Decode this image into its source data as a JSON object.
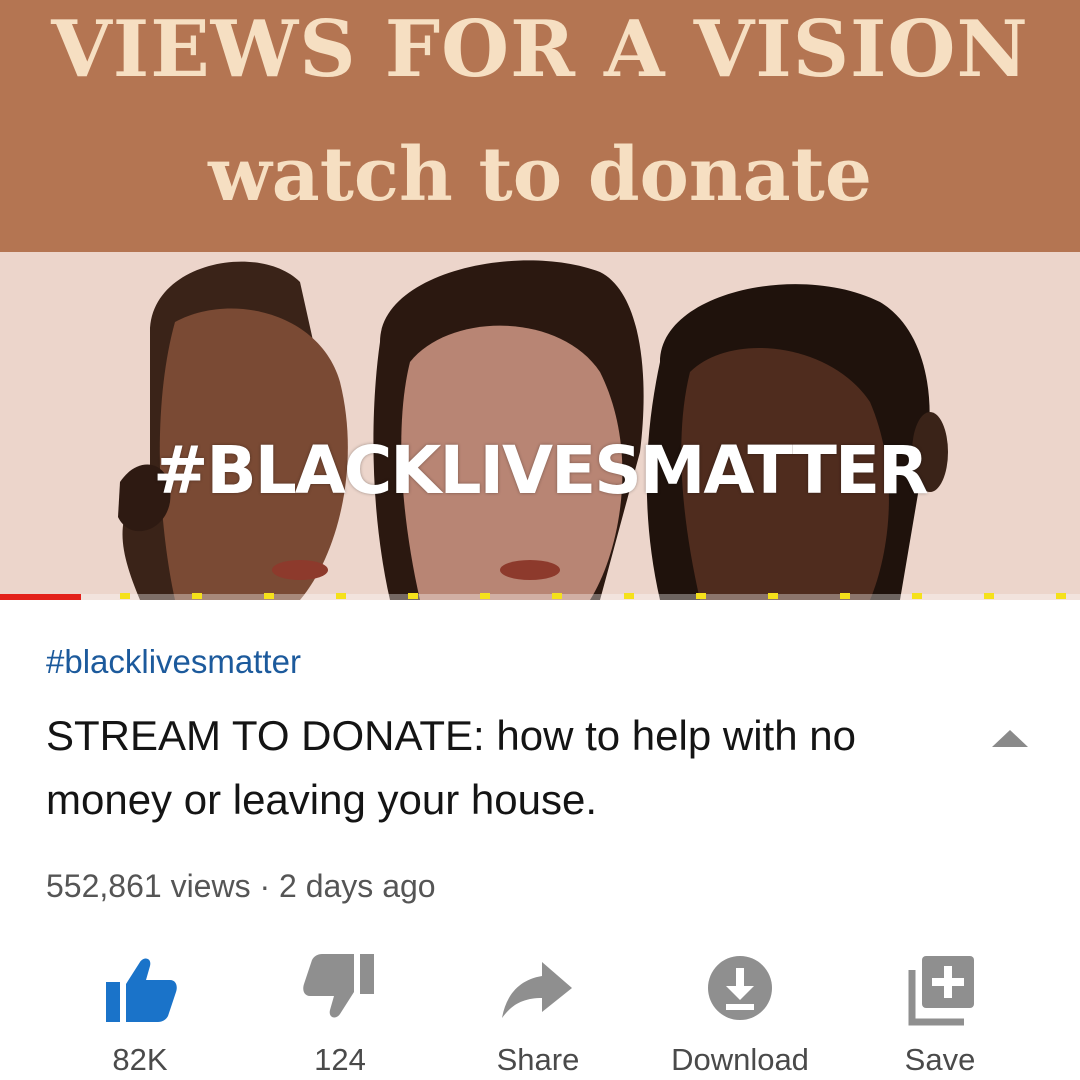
{
  "thumbnail": {
    "banner_title": "VIEWS FOR A VISION",
    "banner_subtitle": "watch to donate",
    "overlay_text": "#BLACKLIVESMATTER",
    "watched_fraction": 0.075
  },
  "video": {
    "hashtag": "#blacklivesmatter",
    "title": "STREAM TO DONATE: how to help with no money or leaving your house.",
    "meta": "552,861 views · 2 days ago"
  },
  "actions": {
    "like": {
      "icon": "thumbs-up-icon",
      "label": "82K"
    },
    "dislike": {
      "icon": "thumbs-down-icon",
      "label": "124"
    },
    "share": {
      "icon": "share-arrow-icon",
      "label": "Share"
    },
    "download": {
      "icon": "download-icon",
      "label": "Download"
    },
    "save": {
      "icon": "playlist-add-icon",
      "label": "Save"
    }
  },
  "colors": {
    "banner": "#b47552",
    "banner_text": "#f6dfc2",
    "link": "#1c5a9c",
    "like_active": "#1a73c9",
    "progress": "#e32119",
    "ad_marker": "#f5e11b"
  }
}
